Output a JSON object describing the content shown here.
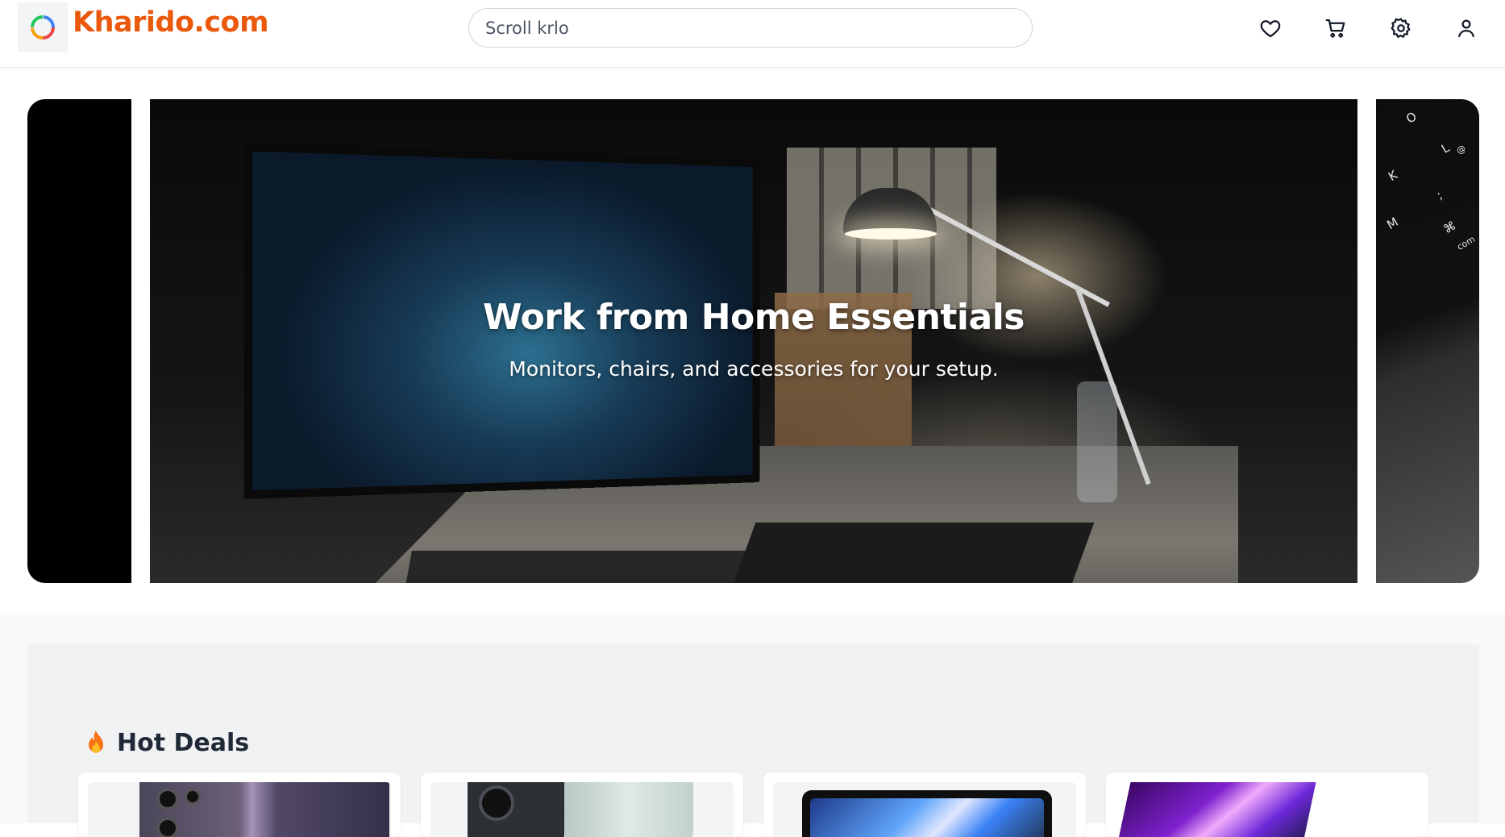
{
  "header": {
    "brand": "Kharido.com",
    "logo_icon": "circular-arrows-logo",
    "search": {
      "placeholder": "Scroll krlo",
      "value": ""
    },
    "icons": [
      "heart-icon",
      "cart-icon",
      "gear-icon",
      "user-icon"
    ]
  },
  "carousel": {
    "slide": {
      "title": "Work from Home Essentials",
      "subtitle": "Monitors, chairs, and accessories for your setup."
    },
    "next_slide_keys": [
      "O",
      "L",
      "@",
      "K",
      ";",
      "M",
      "⌘",
      "com"
    ]
  },
  "deals": {
    "title": "Hot Deals",
    "icon": "fire-icon",
    "cards": [
      {
        "image": "samsung-phones"
      },
      {
        "image": "iphone-cases"
      },
      {
        "image": "macbook-laptop"
      },
      {
        "image": "purple-laptop"
      }
    ]
  },
  "colors": {
    "brand": "#ea580c",
    "text": "#1f2937",
    "section_bg": "#f1f2f4"
  }
}
